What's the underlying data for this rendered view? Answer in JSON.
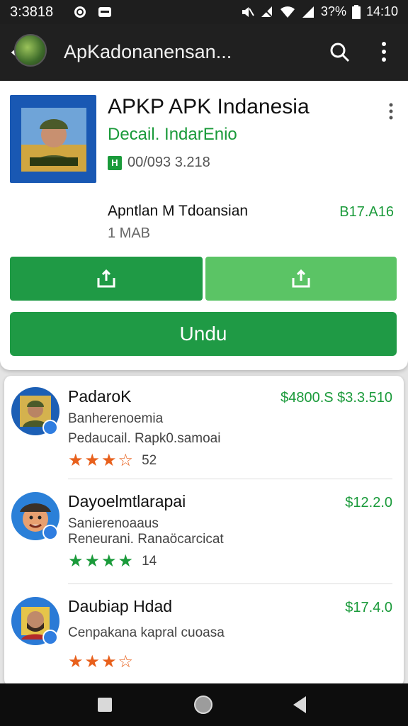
{
  "status_bar": {
    "time": "3:3818",
    "battery": "3?%",
    "clock": "14:10",
    "icons": [
      "whatsapp-icon",
      "notification-icon",
      "mute-icon",
      "no-signal-icon",
      "wifi-icon",
      "signal-icon",
      "battery-icon"
    ]
  },
  "app_bar": {
    "title": "ApKadonanensan...",
    "icons": [
      "back-icon",
      "search-icon",
      "more-vert-icon"
    ]
  },
  "app": {
    "title": "APKP APK Indanesia",
    "developer": "Decail. IndarEnio",
    "rating": "00/093 3.218",
    "rating_badge": "H",
    "info_name": "Apntlan M Tdoansian",
    "info_size": "1 MAB",
    "info_price": "B17.A16",
    "install_label": "Undu",
    "colors": {
      "primary_green": "#1f9a45",
      "light_green": "#5bc465",
      "dev_green": "#1a9a3a"
    }
  },
  "list": {
    "items": [
      {
        "name": "PadaroK",
        "price": "$4800.S $3.3.510",
        "sub1": "Banherenoemia",
        "sub2": "Pedaucail. Rapk0.samoai",
        "count": "52",
        "stars_filled": 3.5,
        "star_color": "#e8601c"
      },
      {
        "name": "Dayoelmtlarapai",
        "price": "$12.2.0",
        "sub1": "Sanierenoaaus",
        "sub2": "Reneurani. Ranaöcarcicat",
        "count": "14",
        "stars_filled": 4,
        "star_color": "#1a9a3a"
      },
      {
        "name": "Daubiap Hdad",
        "price": "$17.4.0",
        "sub1": "Cenpakana kapral cuoasa",
        "sub2": "",
        "count": "",
        "stars_filled": 3,
        "star_color": "#e8601c"
      }
    ]
  },
  "nav_bar": {
    "icons": [
      "recents-icon",
      "home-icon",
      "back-nav-icon"
    ]
  }
}
